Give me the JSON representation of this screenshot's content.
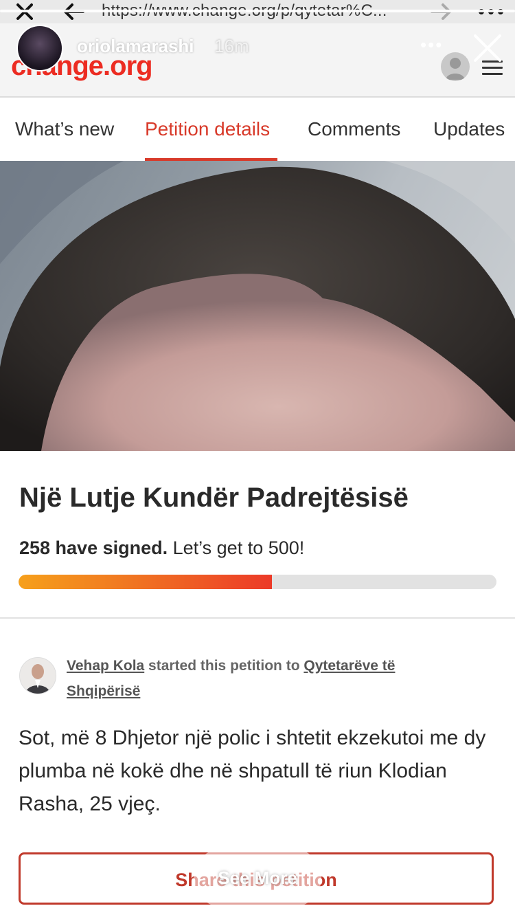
{
  "browser": {
    "url": "https://www.change.org/p/qytetar%C...",
    "close_icon": "close-icon",
    "back_icon": "back-arrow-icon",
    "forward_icon": "forward-arrow-icon",
    "menu_icon": "more-dots-icon"
  },
  "site": {
    "logo": "change.org",
    "brand_color": "#ec2c22"
  },
  "story": {
    "username": "oriolamarashi",
    "time": "16m",
    "more": "•••",
    "see_more": "See More"
  },
  "tabs": [
    {
      "label": "What’s new",
      "active": false
    },
    {
      "label": "Petition details",
      "active": true
    },
    {
      "label": "Comments",
      "active": false
    },
    {
      "label": "Updates",
      "active": false
    }
  ],
  "petition": {
    "title": "Një Lutje Kundër Padrejtësisë",
    "signed_count": "258 have signed.",
    "goal_text": " Let’s get to 500!",
    "progress_fraction": 0.53,
    "starter_name": "Vehap Kola",
    "starter_mid": " started this petition to ",
    "target": "Qytetarëve të Shqipërisë",
    "body": "Sot, më 8 Dhjetor një polic i shtetit ekzekutoi me dy plumba në kokë dhe në shpatull të riun Klodian Rasha, 25 vjeç."
  },
  "share": {
    "label": "Share this petition"
  }
}
